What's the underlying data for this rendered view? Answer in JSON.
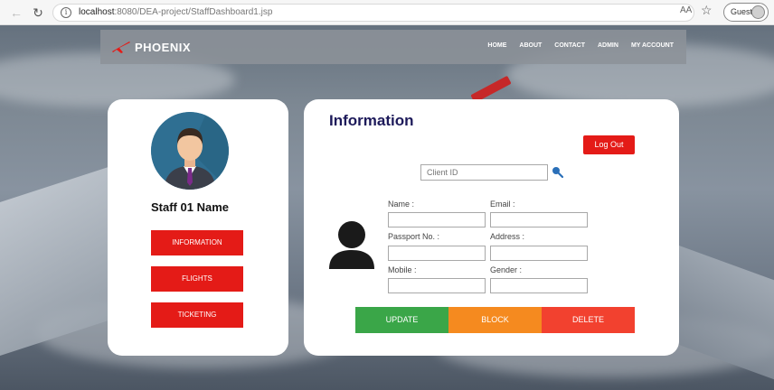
{
  "browser": {
    "url_host": "localhost",
    "url_rest": ":8080/DEA-project/StaffDashboard1.jsp",
    "readaloud": "AΑ",
    "profile_label": "Guest"
  },
  "site": {
    "brand": "PHOENIX",
    "nav": [
      "HOME",
      "ABOUT",
      "CONTACT",
      "ADMIN",
      "MY ACCOUNT"
    ]
  },
  "staff": {
    "name": "Staff 01 Name",
    "menu": [
      "INFORMATION",
      "FLIGHTS",
      "TICKETING"
    ]
  },
  "information": {
    "title": "Information",
    "logout": "Log Out",
    "client_id_placeholder": "Client ID",
    "fields": {
      "name": "Name :",
      "email": "Email :",
      "passport": "Passport No. :",
      "address": "Address :",
      "mobile": "Mobile :",
      "gender": "Gender :"
    },
    "actions": {
      "update": "UPDATE",
      "block": "BLOCK",
      "delete": "DELETE"
    }
  },
  "colors": {
    "accent_red": "#e41b17",
    "update_green": "#3aa648",
    "block_orange": "#f58a1f",
    "delete_red": "#f2412f",
    "title_navy": "#1d1a5a"
  }
}
